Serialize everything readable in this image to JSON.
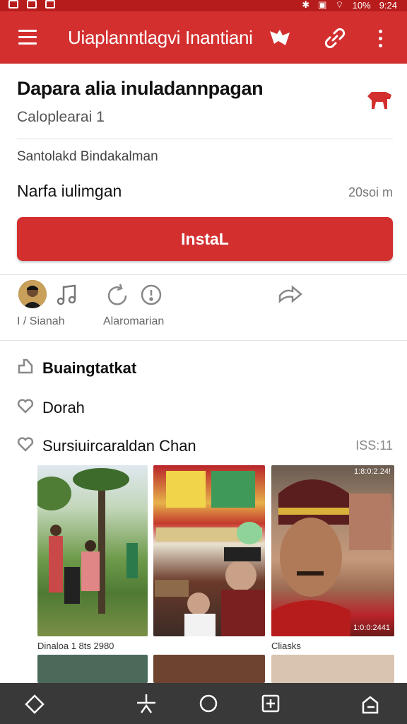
{
  "status_bar": {
    "time": "9:24",
    "battery": "10%"
  },
  "app_bar": {
    "title": "Uiaplanntlagvi Inantiani"
  },
  "app": {
    "name": "Dapara alia inuladannpagan",
    "subtitle": "Caloplearai 1",
    "developer": "Santolakd Bindakalman",
    "size_label": "Narfa iulimgan",
    "size_value": "20soi m",
    "install_label": "InstaL"
  },
  "stats": {
    "left_label": "I / Sianah",
    "mid_label": "Alaromarian"
  },
  "sections": [
    {
      "label": "Buaingtatkat"
    },
    {
      "label": "Dorah"
    },
    {
      "label": "Sursiuircaraldan Chan",
      "value": "ISS:11"
    }
  ],
  "screenshots": {
    "tile1_overlay": "",
    "tile3_overlay": "1:8:0:2.24!",
    "tile3_corner": "1:0:0:2441",
    "caption1": "Dinaloa 1 8ts 2980",
    "caption3": "Cliasks"
  },
  "colors": {
    "accent": "#d32f2f",
    "status_bar": "#b71c1c"
  },
  "icons": [
    "menu-icon",
    "tag-icon",
    "link-icon",
    "more-icon",
    "badge-icon",
    "music-icon",
    "refresh-icon",
    "info-icon",
    "share-icon",
    "thumb-icon",
    "heart-icon",
    "chat-icon",
    "home-icon",
    "filter-icon",
    "circle-icon",
    "plus-square-icon",
    "recent-icon"
  ]
}
